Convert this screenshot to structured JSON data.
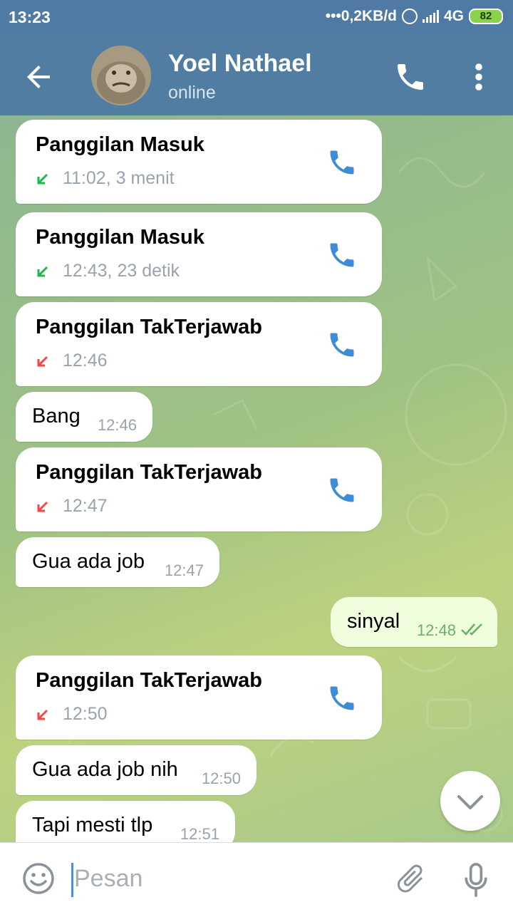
{
  "status_bar": {
    "time": "13:23",
    "network_speed": "0,2KB/d",
    "network_type": "4G",
    "battery": "82"
  },
  "header": {
    "contact_name": "Yoel Nathael",
    "status": "online",
    "back_icon": "arrow-back-icon",
    "call_icon": "phone-icon",
    "menu_icon": "more-vert-icon"
  },
  "messages": [
    {
      "kind": "call",
      "title": "Panggilan Masuk",
      "meta": "11:02, 3 menit",
      "direction": "incoming",
      "arrow_color": "#1fb84b"
    },
    {
      "kind": "call",
      "title": "Panggilan Masuk",
      "meta": "12:43, 23 detik",
      "direction": "incoming",
      "arrow_color": "#1fb84b"
    },
    {
      "kind": "call",
      "title": "Panggilan TakTerjawab",
      "meta": "12:46",
      "direction": "missed",
      "arrow_color": "#f04747"
    },
    {
      "kind": "text",
      "text": "Bang",
      "time": "12:46"
    },
    {
      "kind": "call",
      "title": "Panggilan TakTerjawab",
      "meta": "12:47",
      "direction": "missed",
      "arrow_color": "#f04747"
    },
    {
      "kind": "text",
      "text": "Gua ada job",
      "time": "12:47"
    },
    {
      "kind": "text_out",
      "text": "sinyal",
      "time": "12:48",
      "status": "read"
    },
    {
      "kind": "call",
      "title": "Panggilan TakTerjawab",
      "meta": "12:50",
      "direction": "missed",
      "arrow_color": "#f04747"
    },
    {
      "kind": "text",
      "text": "Gua ada job nih",
      "time": "12:50"
    },
    {
      "kind": "text",
      "text": "Tapi mesti tlp",
      "time": "12:51"
    }
  ],
  "composer": {
    "placeholder": "Pesan",
    "value": ""
  },
  "colors": {
    "header": "#527da3",
    "accent_phone": "#3d8dd6",
    "incoming_arrow": "#1fb84b",
    "missed_arrow": "#f04747",
    "outgoing_bubble": "#effedd"
  }
}
